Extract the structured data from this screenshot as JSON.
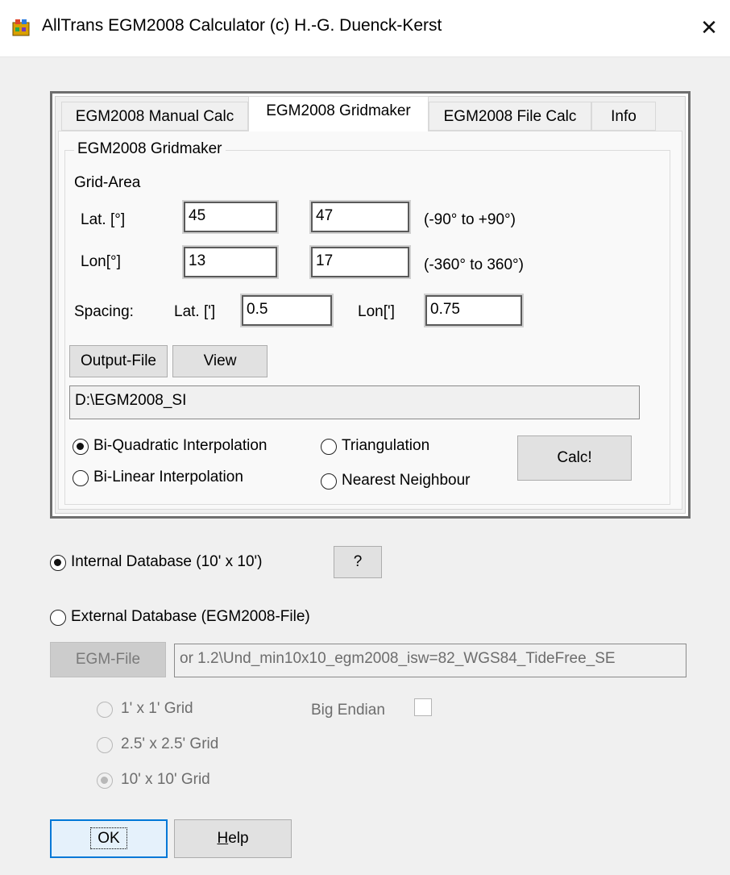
{
  "window": {
    "title": "AllTrans EGM2008 Calculator (c) H.-G. Duenck-Kerst",
    "close_glyph": "✕",
    "app_icon": "app-icon"
  },
  "tabs": [
    {
      "label": "EGM2008 Manual Calc",
      "active": false
    },
    {
      "label": "EGM2008 Gridmaker",
      "active": true
    },
    {
      "label": "EGM2008 File Calc",
      "active": false
    },
    {
      "label": "Info",
      "active": false
    }
  ],
  "gridmaker": {
    "group_title": "EGM2008 Gridmaker",
    "grid_area_label": "Grid-Area",
    "lat_label": "Lat. [°]",
    "lat_from": "45",
    "lat_to": "47",
    "lat_range_hint": "(-90° to +90°)",
    "lon_label": "Lon[°]",
    "lon_from": "13",
    "lon_to": "17",
    "lon_range_hint": "(-360° to 360°)",
    "spacing_label": "Spacing:",
    "spacing_lat_label": "Lat. [']",
    "spacing_lat_value": "0.5",
    "spacing_lon_label": "Lon[']",
    "spacing_lon_value": "0.75",
    "output_file_button": "Output-File",
    "view_button": "View",
    "output_path": "D:\\EGM2008_SI",
    "interpolation": {
      "bi_quadratic": {
        "label": "Bi-Quadratic Interpolation",
        "checked": true
      },
      "bi_linear": {
        "label": "Bi-Linear Interpolation",
        "checked": false
      },
      "triangulation": {
        "label": "Triangulation",
        "checked": false
      },
      "nearest_neighbour": {
        "label": "Nearest Neighbour",
        "checked": false
      }
    },
    "calc_button": "Calc!"
  },
  "database": {
    "internal": {
      "label": "Internal Database (10' x 10')",
      "checked": true
    },
    "help_button": "?",
    "external": {
      "label": "External Database (EGM2008-File)",
      "checked": false
    },
    "egm_file_button": "EGM-File",
    "egm_file_path": "or 1.2\\Und_min10x10_egm2008_isw=82_WGS84_TideFree_SE",
    "grid_1x1": {
      "label": "1' x 1' Grid",
      "checked": false
    },
    "grid_2_5": {
      "label": "2.5' x 2.5'  Grid",
      "checked": false
    },
    "grid_10": {
      "label": "10' x 10'  Grid",
      "checked": true
    },
    "big_endian_label": "Big Endian",
    "big_endian_checked": false
  },
  "footer": {
    "ok_button": "OK",
    "help_button": "Help",
    "help_accelerator": "H",
    "help_rest": "elp"
  }
}
